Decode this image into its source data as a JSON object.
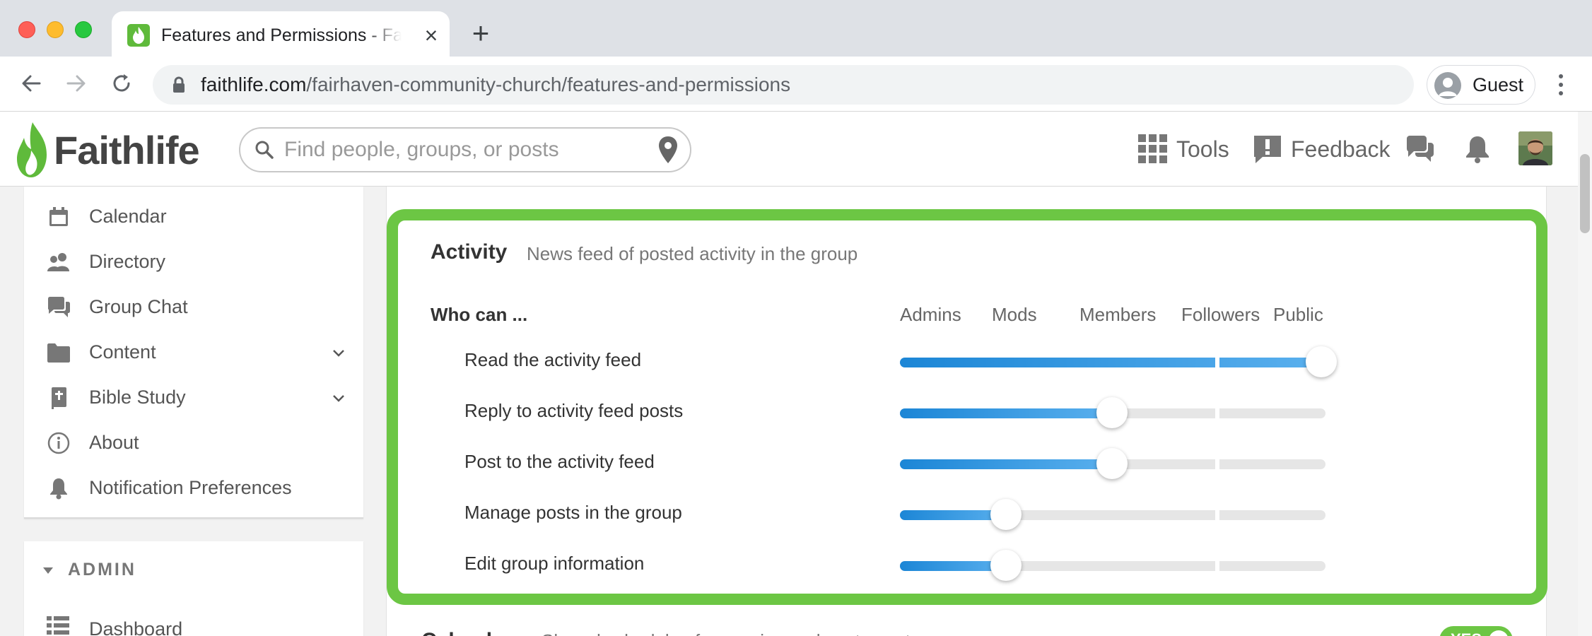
{
  "browser": {
    "tab_title": "Features and Permissions - Faithlife",
    "url_domain": "faithlife.com",
    "url_path": "/fairhaven-community-church/features-and-permissions",
    "profile_label": "Guest",
    "icons": [
      "back-arrow-icon",
      "forward-arrow-icon",
      "reload-icon",
      "lock-icon",
      "profile-icon",
      "close-icon",
      "plus-icon",
      "kebab-menu-icon"
    ]
  },
  "header": {
    "logo_text": "Faithlife",
    "search_placeholder": "Find people, groups, or posts",
    "tools_label": "Tools",
    "feedback_label": "Feedback",
    "brand_color": "#6cc644"
  },
  "sidebar": {
    "items": [
      {
        "label": "Calendar",
        "icon": "calendar-icon"
      },
      {
        "label": "Directory",
        "icon": "people-icon"
      },
      {
        "label": "Group Chat",
        "icon": "chat-icon"
      },
      {
        "label": "Content",
        "icon": "folder-icon"
      },
      {
        "label": "Bible Study",
        "icon": "bible-icon"
      },
      {
        "label": "About",
        "icon": "info-icon"
      },
      {
        "label": "Notification Preferences",
        "icon": "bell-icon"
      }
    ],
    "admin_heading": "ADMIN",
    "admin_items": [
      {
        "label": "Dashboard",
        "icon": "dashboard-icon"
      }
    ]
  },
  "activity": {
    "title": "Activity",
    "description": "News feed of posted activity in the group",
    "who_can": "Who can ...",
    "columns": [
      "Admins",
      "Mods",
      "Members",
      "Followers",
      "Public"
    ],
    "permissions": [
      {
        "label": "Read the activity feed",
        "level": "Public"
      },
      {
        "label": "Reply to activity feed posts",
        "level": "Members"
      },
      {
        "label": "Post to the activity feed",
        "level": "Members"
      },
      {
        "label": "Manage posts in the group",
        "level": "Mods"
      },
      {
        "label": "Edit group information",
        "level": "Mods"
      }
    ],
    "slider_color": "#1c86d6"
  },
  "next_section": {
    "title": "Calendar",
    "description": "Shared schedule of upcoming and past events",
    "toggle_label": "YES"
  }
}
